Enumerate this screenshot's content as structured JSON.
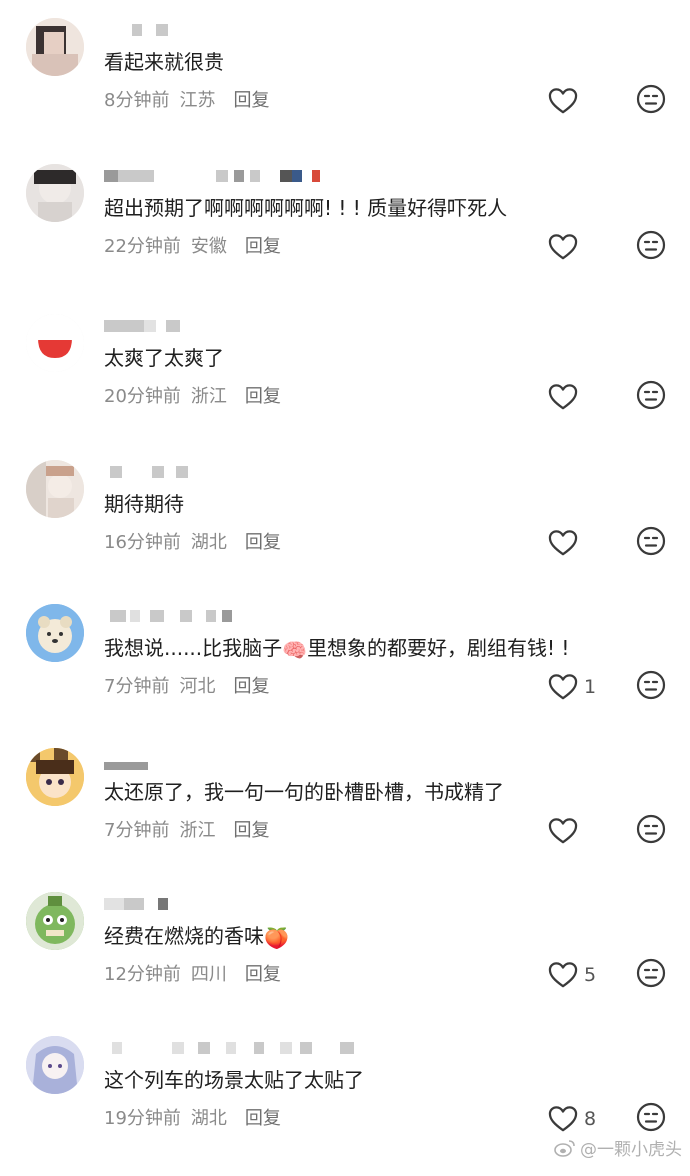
{
  "comments": [
    {
      "text": "看起来就很贵",
      "time": "8分钟前",
      "location": "江苏",
      "reply": "回复",
      "likes": ""
    },
    {
      "text": "超出预期了啊啊啊啊啊啊! ! !  质量好得吓死人",
      "time": "22分钟前",
      "location": "安徽",
      "reply": "回复",
      "likes": ""
    },
    {
      "text": "太爽了太爽了",
      "time": "20分钟前",
      "location": "浙江",
      "reply": "回复",
      "likes": ""
    },
    {
      "text": "期待期待",
      "time": "16分钟前",
      "location": "湖北",
      "reply": "回复",
      "likes": ""
    },
    {
      "text_before": "我想说......比我脑子",
      "emoji": "🧠",
      "text_after": "里想象的都要好，剧组有钱! !",
      "time": "7分钟前",
      "location": "河北",
      "reply": "回复",
      "likes": "1"
    },
    {
      "text": "太还原了，我一句一句的卧槽卧槽，书成精了",
      "time": "7分钟前",
      "location": "浙江",
      "reply": "回复",
      "likes": ""
    },
    {
      "text_before": "经费在燃烧的香味",
      "emoji": "🍑",
      "time": "12分钟前",
      "location": "四川",
      "reply": "回复",
      "likes": "5"
    },
    {
      "text": "这个列车的场景太贴了太贴了",
      "time": "19分钟前",
      "location": "湖北",
      "reply": "回复",
      "likes": "8"
    }
  ],
  "watermark": "@一颗小虎头",
  "watermark_icon": "weibo-icon",
  "colors": {
    "meta": "#8a8a8a",
    "icon": "#3a3a3a",
    "text": "#1f1f1f"
  }
}
